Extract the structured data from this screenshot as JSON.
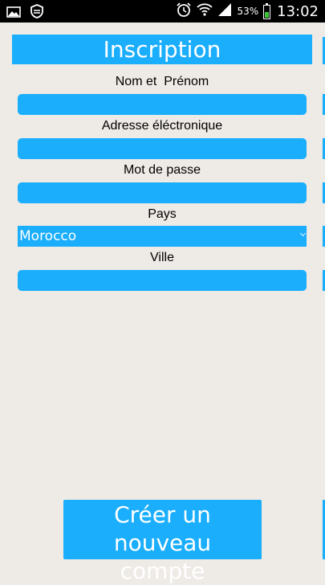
{
  "status_bar": {
    "battery_percent": "53%",
    "time": "13:02",
    "left_icons": [
      "gallery-icon",
      "shield-icon"
    ],
    "right_icons": [
      "alarm-icon",
      "wifi-icon",
      "signal-icon",
      "battery-icon"
    ],
    "battery_level": 0.53,
    "battery_color": "#3ec23a"
  },
  "form": {
    "title": "Inscription",
    "fields": [
      {
        "label": "Nom et  Prénom",
        "value": ""
      },
      {
        "label": "Adresse éléctronique",
        "value": ""
      },
      {
        "label": "Mot de passe",
        "value": ""
      },
      {
        "label": "Pays",
        "selected": "Morocco"
      },
      {
        "label": "Ville",
        "value": ""
      }
    ],
    "submit_line1": "Créer un nouveau",
    "submit_line2": "compte"
  },
  "colors": {
    "accent": "#1aaefc",
    "background": "#eeeae6",
    "status_bar": "#000000"
  }
}
